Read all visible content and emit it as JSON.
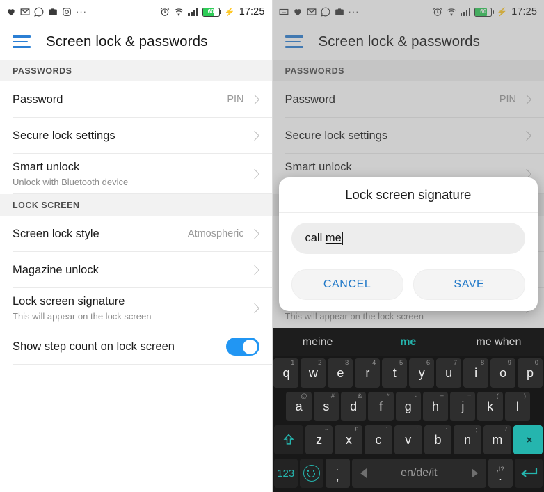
{
  "statusbar": {
    "left_icons": [
      "heart-rate-icon",
      "gmail-icon",
      "whatsapp-icon",
      "camera-icon",
      "instagram-icon"
    ],
    "left_icons_right": [
      "keyboard-icon",
      "heart-rate-icon",
      "gmail-icon",
      "whatsapp-icon",
      "camera-icon"
    ],
    "overflow": "···",
    "alarm_icon": "alarm-icon",
    "wifi_icon": "wifi-icon",
    "signal_icon": "signal-bars-icon",
    "battery_level": "60",
    "charging_icon": "⚡",
    "time": "17:25"
  },
  "appbar": {
    "menu_icon": "hamburger-menu-icon",
    "title": "Screen lock & passwords"
  },
  "sections": [
    {
      "header": "PASSWORDS",
      "rows": [
        {
          "title": "Password",
          "sub": "",
          "value": "PIN",
          "control": "chevron"
        },
        {
          "title": "Secure lock settings",
          "sub": "",
          "value": "",
          "control": "chevron"
        },
        {
          "title": "Smart unlock",
          "sub": "Unlock with Bluetooth device",
          "value": "",
          "control": "chevron"
        }
      ]
    },
    {
      "header": "LOCK SCREEN",
      "rows": [
        {
          "title": "Screen lock style",
          "sub": "",
          "value": "Atmospheric",
          "control": "chevron"
        },
        {
          "title": "Magazine unlock",
          "sub": "",
          "value": "",
          "control": "chevron"
        },
        {
          "title": "Lock screen signature",
          "sub": "This will appear on the lock screen",
          "value": "",
          "control": "chevron"
        },
        {
          "title": "Show step count on lock screen",
          "sub": "",
          "value": "",
          "control": "toggle_on"
        }
      ]
    }
  ],
  "dialog": {
    "title": "Lock screen signature",
    "input_text_plain": "call ",
    "input_text_suggested": "me",
    "input_placeholder": "",
    "cancel_label": "CANCEL",
    "save_label": "SAVE"
  },
  "keyboard": {
    "suggestions": [
      {
        "text": "meine",
        "active": false
      },
      {
        "text": "me",
        "active": true
      },
      {
        "text": "me when",
        "active": false
      }
    ],
    "row1": [
      {
        "k": "q",
        "hint": "1"
      },
      {
        "k": "w",
        "hint": "2"
      },
      {
        "k": "e",
        "hint": "3"
      },
      {
        "k": "r",
        "hint": "4"
      },
      {
        "k": "t",
        "hint": "5"
      },
      {
        "k": "y",
        "hint": "6"
      },
      {
        "k": "u",
        "hint": "7"
      },
      {
        "k": "i",
        "hint": "8"
      },
      {
        "k": "o",
        "hint": "9"
      },
      {
        "k": "p",
        "hint": "0"
      }
    ],
    "row2": [
      {
        "k": "a",
        "hint": "@"
      },
      {
        "k": "s",
        "hint": "#"
      },
      {
        "k": "d",
        "hint": "&"
      },
      {
        "k": "f",
        "hint": "*"
      },
      {
        "k": "g",
        "hint": "-"
      },
      {
        "k": "h",
        "hint": "+"
      },
      {
        "k": "j",
        "hint": "="
      },
      {
        "k": "k",
        "hint": "("
      },
      {
        "k": "l",
        "hint": ")"
      }
    ],
    "row3": [
      {
        "k": "z",
        "hint": "~"
      },
      {
        "k": "x",
        "hint": "£"
      },
      {
        "k": "c",
        "hint": "´"
      },
      {
        "k": "v",
        "hint": "'"
      },
      {
        "k": "b",
        "hint": ":"
      },
      {
        "k": "n",
        "hint": ";"
      },
      {
        "k": "m",
        "hint": "/"
      }
    ],
    "shift_icon": "shift-arrow-icon",
    "backspace_icon": "backspace-icon",
    "numeric_label": "123",
    "emoji_icon": "emoji-smiley-icon",
    "comma_top": "·",
    "comma_bottom": ",",
    "space_label": "en/de/it",
    "period_top": ",!?",
    "period_bottom": ".",
    "enter_icon": "enter-arrow-icon"
  },
  "colors": {
    "accent_blue": "#2196f3",
    "link_blue": "#1f78c8",
    "menu_blue": "#2b7fd4",
    "keyboard_teal": "#25b5ae",
    "battery_green": "#2ecc57",
    "section_bg": "#f2f2f2"
  }
}
